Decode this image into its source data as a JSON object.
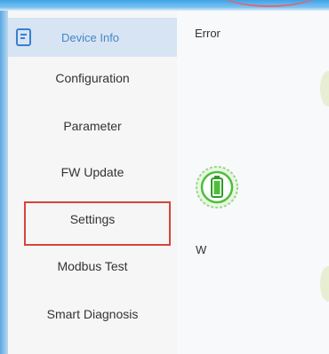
{
  "sidebar": {
    "items": [
      {
        "label": "Device Info",
        "active": true,
        "icon": "document-icon"
      },
      {
        "label": "Configuration",
        "active": false
      },
      {
        "label": "Parameter",
        "active": false
      },
      {
        "label": "FW Update",
        "active": false
      },
      {
        "label": "Settings",
        "active": false,
        "highlighted": true
      },
      {
        "label": "Modbus Test",
        "active": false
      },
      {
        "label": "Smart Diagnosis",
        "active": false
      }
    ]
  },
  "main": {
    "error_label": "Error",
    "unit_label": "W",
    "battery_icon": "battery-icon"
  },
  "colors": {
    "active_bg": "#d6e4f4",
    "active_text": "#4a86c6",
    "highlight_border": "#d6453c",
    "battery_green": "#4cbf3a"
  }
}
